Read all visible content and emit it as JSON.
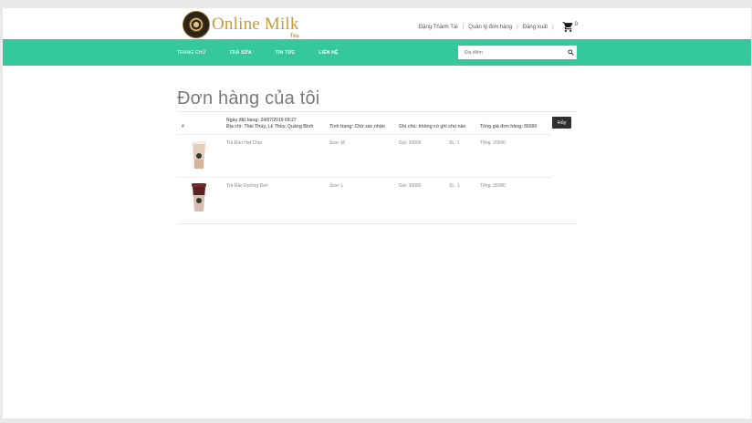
{
  "brand": {
    "name": "Online Milk",
    "sub": "Tea"
  },
  "topbar": {
    "user": "Đặng Thành Tài",
    "orders_link": "Quản lý đơn hàng",
    "logout": "Đăng xuất",
    "cart_count": "0"
  },
  "nav": {
    "items": [
      "TRANG CHỦ",
      "TRÀ SỮA",
      "TIN TỨC",
      "LIÊN HỆ"
    ],
    "search_placeholder": "Địa điểm"
  },
  "page": {
    "title": "Đơn hàng của tôi"
  },
  "order": {
    "hash": "#",
    "date": "Ngày đặt hàng: 24/07/2019 09:27",
    "address": "Địa chỉ: Thái Thủy, Lệ Thủy, Quảng Bình",
    "status": "Tình trạng: Chờ xác nhận",
    "note": "Ghi chú: không có ghi chú nào",
    "total": "Tổng giá đơn hàng: 55000",
    "cancel": "Hủy",
    "items": [
      {
        "name": "Trà Đào Hạt Chia",
        "size": "Size: M",
        "price": "Giá: 20000",
        "qty": "SL: 1",
        "subtotal": "Tổng: 20000",
        "icon": "milk-tea-cup-icon"
      },
      {
        "name": "Trà Đào Đường Đen",
        "size": "Size: L",
        "price": "Giá: 35000",
        "qty": "SL: 1",
        "subtotal": "Tổng: 35000",
        "icon": "brown-sugar-tea-cup-icon"
      }
    ]
  },
  "colors": {
    "nav": "#35c89c",
    "brand": "#c79b3a",
    "button": "#2f2f2f"
  }
}
